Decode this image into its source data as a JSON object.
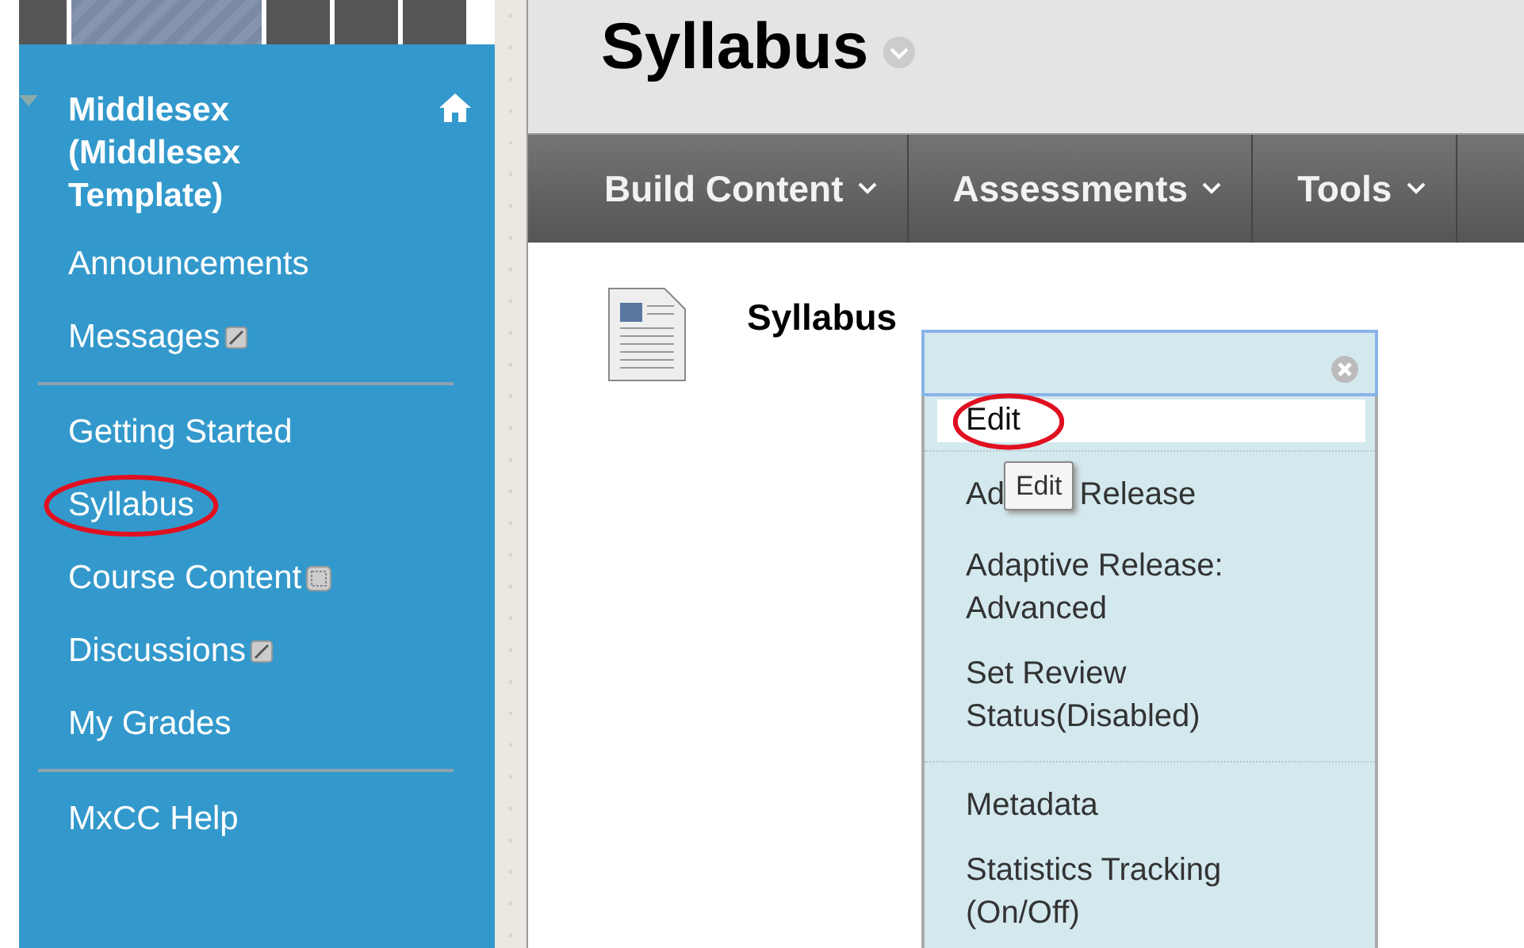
{
  "course_menu": {
    "title": "Middlesex (Middlesex Template)",
    "expanded": true,
    "groups": [
      [
        {
          "label": "Announcements",
          "kind": "plain",
          "highlighted": false
        },
        {
          "label": "Messages",
          "kind": "blocked",
          "highlighted": false
        }
      ],
      [
        {
          "label": "Getting Started",
          "kind": "plain",
          "highlighted": false
        },
        {
          "label": "Syllabus",
          "kind": "plain",
          "highlighted": true
        },
        {
          "label": "Course Content",
          "kind": "framed",
          "highlighted": false
        },
        {
          "label": "Discussions",
          "kind": "blocked",
          "highlighted": false
        },
        {
          "label": "My Grades",
          "kind": "plain",
          "highlighted": false
        }
      ],
      [
        {
          "label": "MxCC Help",
          "kind": "plain",
          "highlighted": false
        }
      ]
    ]
  },
  "page": {
    "title": "Syllabus"
  },
  "action_bar": [
    {
      "label": "Build Content"
    },
    {
      "label": "Assessments"
    },
    {
      "label": "Tools"
    }
  ],
  "content_item": {
    "title": "Syllabus"
  },
  "context_menu": {
    "groups": [
      [
        {
          "label": "Edit",
          "selected": true,
          "highlighted": true
        }
      ],
      [
        {
          "label": "Ad",
          "label_after": "Release",
          "selected": false,
          "highlighted": false
        },
        {
          "label": "Adaptive Release: Advanced",
          "selected": false,
          "highlighted": false
        },
        {
          "label": "Set Review Status(Disabled)",
          "selected": false,
          "highlighted": false
        }
      ],
      [
        {
          "label": "Metadata",
          "selected": false,
          "highlighted": false
        },
        {
          "label": "Statistics Tracking (On/Off)",
          "selected": false,
          "highlighted": false
        }
      ]
    ],
    "tooltip": "Edit"
  }
}
